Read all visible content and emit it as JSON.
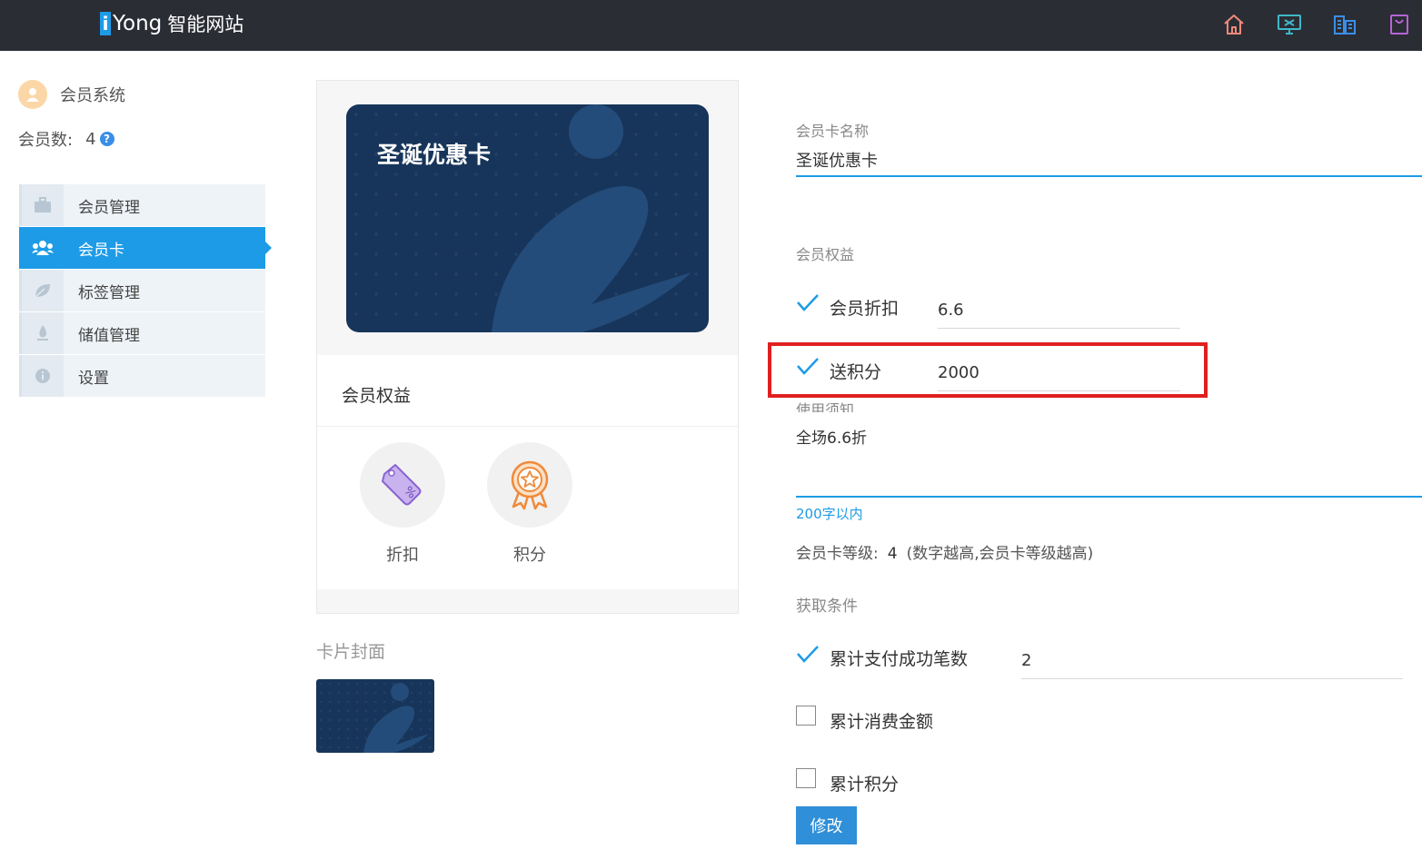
{
  "header": {
    "logo_mark": "i",
    "logo_text": "Yong",
    "logo_sub": "智能网站",
    "icons": [
      "home-icon",
      "monitor-icon",
      "building-icon",
      "bag-icon"
    ],
    "icon_colors": [
      "#f08a7a",
      "#3fb8c8",
      "#3a8ee6",
      "#b565d6"
    ]
  },
  "sidebar": {
    "system_title": "会员系统",
    "member_count_label": "会员数:",
    "member_count": "4",
    "help_glyph": "?",
    "items": [
      {
        "label": "会员管理",
        "icon": "briefcase-icon"
      },
      {
        "label": "会员卡",
        "icon": "users-icon"
      },
      {
        "label": "标签管理",
        "icon": "leaf-icon"
      },
      {
        "label": "储值管理",
        "icon": "drop-icon"
      },
      {
        "label": "设置",
        "icon": "info-icon"
      }
    ]
  },
  "preview": {
    "card_title": "圣诞优惠卡",
    "benefits_title": "会员权益",
    "benefits": [
      {
        "label": "折扣",
        "icon": "discount-tag-icon"
      },
      {
        "label": "积分",
        "icon": "medal-icon"
      }
    ],
    "cover_label": "卡片封面"
  },
  "form": {
    "card_name_label": "会员卡名称",
    "card_name_value": "圣诞优惠卡",
    "benefits_label": "会员权益",
    "discount_label": "会员折扣",
    "discount_value": "6.6",
    "points_label": "送积分",
    "points_value": "2000",
    "notice_label": "使用须知",
    "notice_value": "全场6.6折",
    "notice_hint": "200字以内",
    "level_label": "会员卡等级:",
    "level_value": "4",
    "level_note": "(数字越高,会员卡等级越高)",
    "conditions_label": "获取条件",
    "conditions": [
      {
        "label": "累计支付成功笔数",
        "checked": true,
        "value": "2"
      },
      {
        "label": "累计消费金额",
        "checked": false
      },
      {
        "label": "累计积分",
        "checked": false
      }
    ],
    "submit_label": "修改"
  }
}
